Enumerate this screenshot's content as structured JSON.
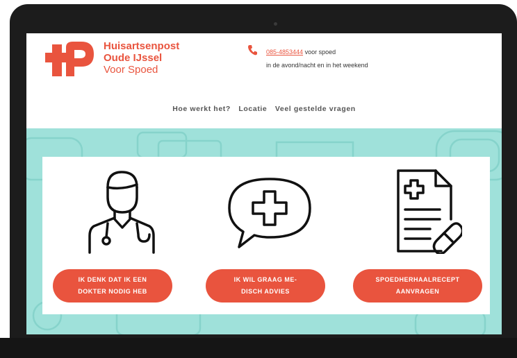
{
  "brand": {
    "name_line1": "Huisartsenpost",
    "name_line2": "Oude IJssel",
    "name_line3": "Voor Spoed",
    "accent_color": "#e9543e"
  },
  "contact": {
    "icon": "phone-icon",
    "phone_number": "085-4853444",
    "line1_suffix": "voor spoed",
    "line2": "in de avond/nacht en in het weekend"
  },
  "nav": {
    "items": [
      {
        "label": "Hoe werkt het?"
      },
      {
        "label": "Locatie"
      },
      {
        "label": "Veel gestelde vragen"
      }
    ]
  },
  "hero": {
    "background_color": "#9fe1da",
    "cards": [
      {
        "icon": "doctor-icon",
        "button_line1": "IK DENK DAT IK EEN",
        "button_line2": "DOKTER NODIG HEB"
      },
      {
        "icon": "medical-advice-speech-bubble-icon",
        "button_line1": "IK WIL GRAAG ME-",
        "button_line2": "DISCH ADVIES"
      },
      {
        "icon": "prescription-document-icon",
        "button_line1": "SPOEDHERHAALRECEPT",
        "button_line2": "AANVRAGEN"
      }
    ]
  }
}
